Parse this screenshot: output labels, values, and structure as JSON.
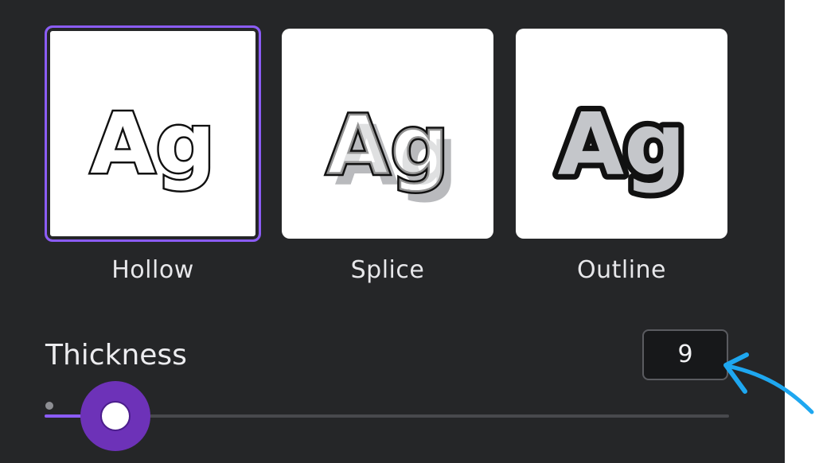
{
  "effects": [
    {
      "id": "hollow",
      "label": "Hollow",
      "preview_text": "Ag",
      "selected": true
    },
    {
      "id": "splice",
      "label": "Splice",
      "preview_text": "Ag",
      "selected": false
    },
    {
      "id": "outline",
      "label": "Outline",
      "preview_text": "Ag",
      "selected": false
    }
  ],
  "thickness": {
    "label": "Thickness",
    "value": "9",
    "min": 0,
    "max": 100,
    "fraction": 0.09
  },
  "colors": {
    "panel_bg": "#252628",
    "accent": "#8b5cf6",
    "annotation_arrow": "#1ea7f0"
  },
  "icons": {
    "annotation": "arrow-icon"
  }
}
